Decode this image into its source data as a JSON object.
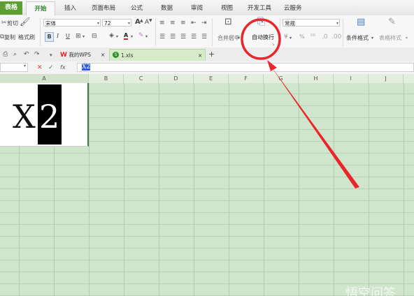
{
  "app_tab": "表格",
  "menu": {
    "tabs": [
      "开始",
      "插入",
      "页面布局",
      "公式",
      "数据",
      "审阅",
      "视图",
      "开发工具",
      "云服务"
    ],
    "active": "开始"
  },
  "ribbon": {
    "cut": "剪切",
    "copy": "复制",
    "format_painter": "格式刷",
    "font_name": "宋体",
    "font_size": "72",
    "bold": "B",
    "italic": "I",
    "underline": "U",
    "font_color": "A",
    "grow_font": "A",
    "shrink_font": "A",
    "merge_center": "合并居中",
    "wrap_text": "自动换行",
    "number_format": "常规",
    "percent": "%",
    "conditional_format": "条件格式",
    "table_style": "表格样式"
  },
  "tabbar": {
    "wps_label": "我的WPS",
    "doc_label": "1.xls",
    "close": "×",
    "add": "+"
  },
  "formula": {
    "fx": "fx",
    "value": "X2"
  },
  "columns": [
    "A",
    "B",
    "C",
    "D",
    "E",
    "F",
    "G",
    "H",
    "I",
    "J"
  ],
  "cell_a1": {
    "text_x": "X",
    "text_2": "2"
  },
  "watermark": "悟空问答",
  "colors": {
    "accent_green": "#5c9e32",
    "grid_bg": "#cfe6cc",
    "annotation_red": "#e8262b"
  }
}
